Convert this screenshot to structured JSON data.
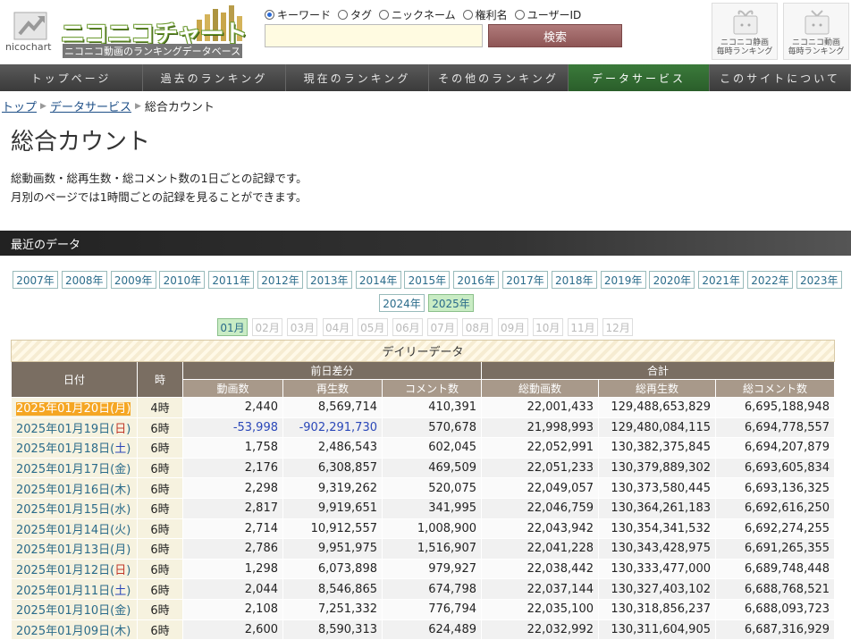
{
  "header": {
    "logo_small": "nicochart",
    "logo_title": "ニコニコチャート",
    "logo_subtitle": "ニコニコ動画のランキングデータベース",
    "search": {
      "options": [
        "キーワード",
        "タグ",
        "ニックネーム",
        "権利名",
        "ユーザーID"
      ],
      "selected": "キーワード",
      "button_label": "検索",
      "value": ""
    },
    "side_links": [
      {
        "line1": "ニコニコ静画",
        "line2": "毎時ランキング"
      },
      {
        "line1": "ニコニコ動画",
        "line2": "毎時ランキング"
      }
    ]
  },
  "nav": {
    "items": [
      "トップページ",
      "過去のランキング",
      "現在のランキング",
      "その他のランキング",
      "データサービス",
      "このサイトについて"
    ],
    "active": "データサービス"
  },
  "breadcrumb": {
    "items": [
      "トップ",
      "データサービス"
    ],
    "current": "総合カウント"
  },
  "page": {
    "title": "総合カウント",
    "desc_line1": "総動画数・総再生数・総コメント数の1日ごとの記録です。",
    "desc_line2": "月別のページでは1時間ごとの記録を見ることができます。",
    "section_title": "最近のデータ"
  },
  "years": {
    "items": [
      "2007年",
      "2008年",
      "2009年",
      "2010年",
      "2011年",
      "2012年",
      "2013年",
      "2014年",
      "2015年",
      "2016年",
      "2017年",
      "2018年",
      "2019年",
      "2020年",
      "2021年",
      "2022年",
      "2023年",
      "2024年",
      "2025年"
    ],
    "active": "2025年"
  },
  "months": {
    "items": [
      "01月",
      "02月",
      "03月",
      "04月",
      "05月",
      "06月",
      "07月",
      "08月",
      "09月",
      "10月",
      "11月",
      "12月"
    ],
    "active": "01月"
  },
  "table": {
    "caption": "デイリーデータ",
    "headers": {
      "date": "日付",
      "hour": "時",
      "diff_group": "前日差分",
      "total_group": "合計",
      "diff_videos": "動画数",
      "diff_views": "再生数",
      "diff_comments": "コメント数",
      "total_videos": "総動画数",
      "total_views": "総再生数",
      "total_comments": "総コメント数"
    },
    "rows": [
      {
        "date": "2025年01月20日",
        "wd": "月",
        "hour": "4時",
        "dv": "2,440",
        "dp": "8,569,714",
        "dc": "410,391",
        "tv": "22,001,433",
        "tp": "129,488,653,829",
        "tc": "6,695,188,948",
        "highlight": true
      },
      {
        "date": "2025年01月19日",
        "wd": "日",
        "hour": "6時",
        "dv": "-53,998",
        "dp": "-902,291,730",
        "dc": "570,678",
        "tv": "21,998,993",
        "tp": "129,480,084,115",
        "tc": "6,694,778,557"
      },
      {
        "date": "2025年01月18日",
        "wd": "土",
        "hour": "6時",
        "dv": "1,758",
        "dp": "2,486,543",
        "dc": "602,045",
        "tv": "22,052,991",
        "tp": "130,382,375,845",
        "tc": "6,694,207,879"
      },
      {
        "date": "2025年01月17日",
        "wd": "金",
        "hour": "6時",
        "dv": "2,176",
        "dp": "6,308,857",
        "dc": "469,509",
        "tv": "22,051,233",
        "tp": "130,379,889,302",
        "tc": "6,693,605,834"
      },
      {
        "date": "2025年01月16日",
        "wd": "木",
        "hour": "6時",
        "dv": "2,298",
        "dp": "9,319,262",
        "dc": "520,075",
        "tv": "22,049,057",
        "tp": "130,373,580,445",
        "tc": "6,693,136,325"
      },
      {
        "date": "2025年01月15日",
        "wd": "水",
        "hour": "6時",
        "dv": "2,817",
        "dp": "9,919,651",
        "dc": "341,995",
        "tv": "22,046,759",
        "tp": "130,364,261,183",
        "tc": "6,692,616,250"
      },
      {
        "date": "2025年01月14日",
        "wd": "火",
        "hour": "6時",
        "dv": "2,714",
        "dp": "10,912,557",
        "dc": "1,008,900",
        "tv": "22,043,942",
        "tp": "130,354,341,532",
        "tc": "6,692,274,255"
      },
      {
        "date": "2025年01月13日",
        "wd": "月",
        "hour": "6時",
        "dv": "2,786",
        "dp": "9,951,975",
        "dc": "1,516,907",
        "tv": "22,041,228",
        "tp": "130,343,428,975",
        "tc": "6,691,265,355"
      },
      {
        "date": "2025年01月12日",
        "wd": "日",
        "hour": "6時",
        "dv": "1,298",
        "dp": "6,073,898",
        "dc": "979,927",
        "tv": "22,038,442",
        "tp": "130,333,477,000",
        "tc": "6,689,748,448"
      },
      {
        "date": "2025年01月11日",
        "wd": "土",
        "hour": "6時",
        "dv": "2,044",
        "dp": "8,546,865",
        "dc": "674,798",
        "tv": "22,037,144",
        "tp": "130,327,403,102",
        "tc": "6,688,768,521"
      },
      {
        "date": "2025年01月10日",
        "wd": "金",
        "hour": "6時",
        "dv": "2,108",
        "dp": "7,251,332",
        "dc": "776,794",
        "tv": "22,035,100",
        "tp": "130,318,856,237",
        "tc": "6,688,093,723"
      },
      {
        "date": "2025年01月09日",
        "wd": "木",
        "hour": "6時",
        "dv": "2,600",
        "dp": "8,590,313",
        "dc": "624,489",
        "tv": "22,032,992",
        "tp": "130,311,604,905",
        "tc": "6,687,316,929"
      }
    ]
  },
  "colors": {
    "nav_active": "#2a5e2a",
    "highlight_date": "#f5a623",
    "negative": "#2a47b8",
    "link": "#2a6b8a"
  }
}
